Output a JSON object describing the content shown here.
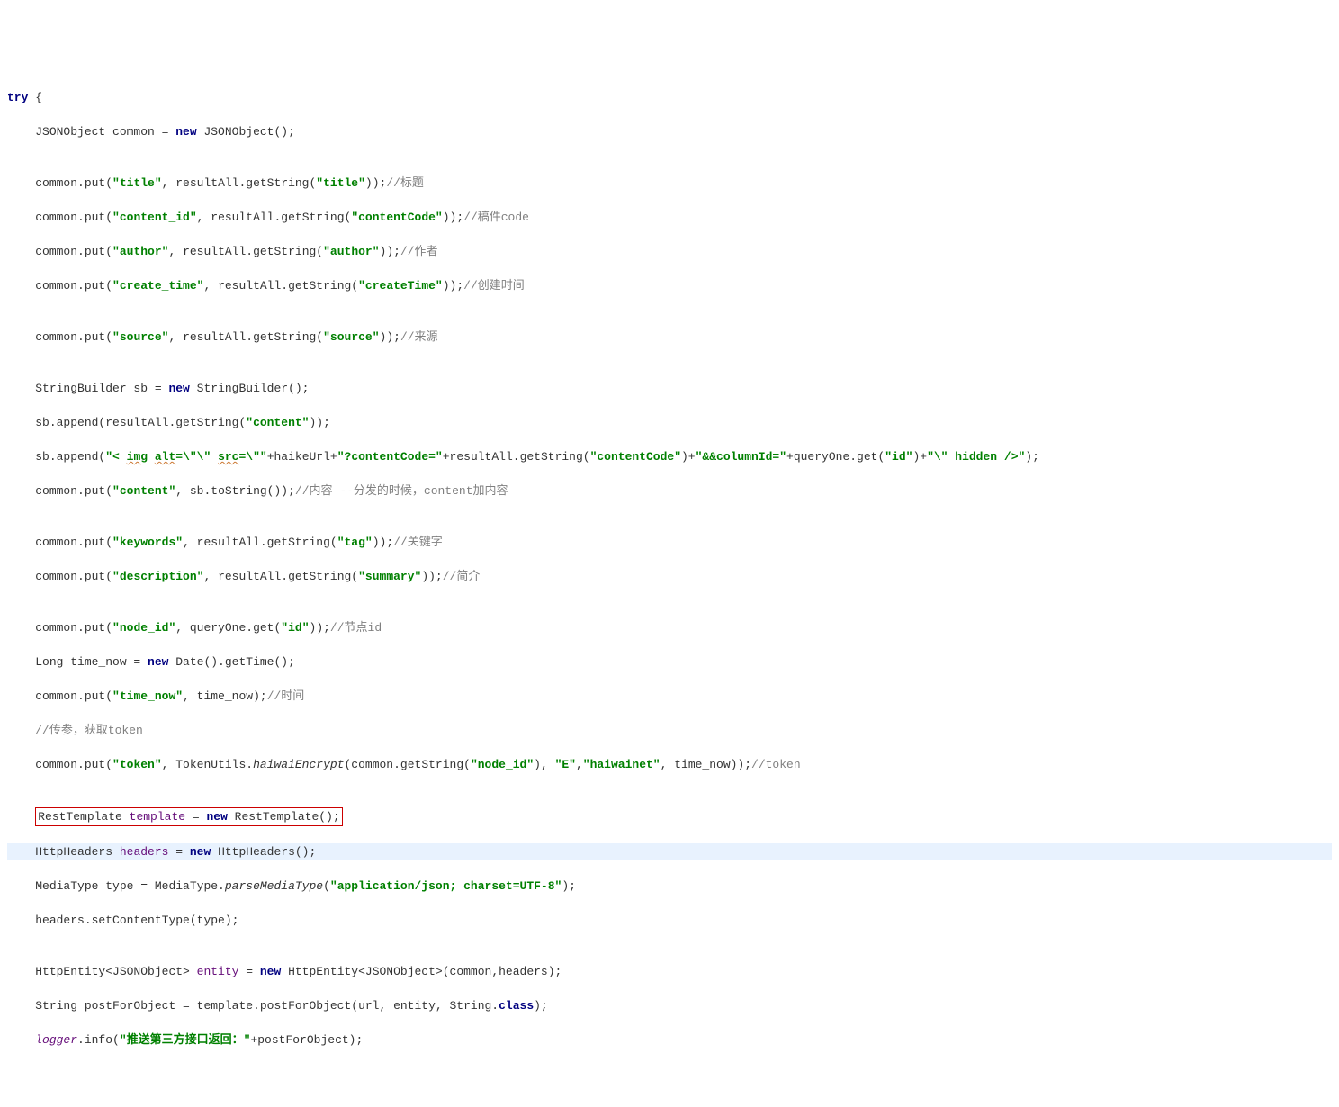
{
  "code": {
    "l1": {
      "kw": "try",
      "brace": " {"
    },
    "l2": {
      "p1": "JSONObject common = ",
      "kw": "new",
      "p2": " JSONObject();"
    },
    "l3": {
      "p1": "common.put(",
      "s1": "\"title\"",
      "p2": ", resultAll.getString(",
      "s2": "\"title\"",
      "p3": "));",
      "c": "//标题"
    },
    "l4": {
      "p1": "common.put(",
      "s1": "\"content_id\"",
      "p2": ", resultAll.getString(",
      "s2": "\"contentCode\"",
      "p3": "));",
      "c": "//稿件code"
    },
    "l5": {
      "p1": "common.put(",
      "s1": "\"author\"",
      "p2": ", resultAll.getString(",
      "s2": "\"author\"",
      "p3": "));",
      "c": "//作者"
    },
    "l6": {
      "p1": "common.put(",
      "s1": "\"create_time\"",
      "p2": ", resultAll.getString(",
      "s2": "\"createTime\"",
      "p3": "));",
      "c": "//创建时间"
    },
    "l7": {
      "p1": "common.put(",
      "s1": "\"source\"",
      "p2": ", resultAll.getString(",
      "s2": "\"source\"",
      "p3": "));",
      "c": "//来源"
    },
    "l8": {
      "p1": "StringBuilder sb = ",
      "kw": "new",
      "p2": " StringBuilder();"
    },
    "l9": {
      "p1": "sb.append(resultAll.getString(",
      "s1": "\"content\"",
      "p2": "));"
    },
    "l10": {
      "p1": "sb.append(",
      "s1": "\"< ",
      "w1": "img",
      "s2": " ",
      "w2": "alt",
      "s3": "=\\\"\\\" ",
      "w3": "src",
      "s4": "=\\\"\"",
      "p2": "+haikeUrl+",
      "s5": "\"?contentCode=\"",
      "p3": "+resultAll.getString(",
      "s6": "\"contentCode\"",
      "p4": ")+",
      "s7": "\"&&columnId=\"",
      "p5": "+queryOne.get(",
      "s8": "\"id\"",
      "p6": ")+",
      "s9": "\"\\\" hidden />\"",
      "p7": ");"
    },
    "l11": {
      "p1": "common.put(",
      "s1": "\"content\"",
      "p2": ", sb.toString());",
      "c": "//内容 --分发的时候，content加内容"
    },
    "l12": {
      "p1": "common.put(",
      "s1": "\"keywords\"",
      "p2": ", resultAll.getString(",
      "s2": "\"tag\"",
      "p3": "));",
      "c": "//关键字"
    },
    "l13": {
      "p1": "common.put(",
      "s1": "\"description\"",
      "p2": ", resultAll.getString(",
      "s2": "\"summary\"",
      "p3": "));",
      "c": "//简介"
    },
    "l14": {
      "p1": "common.put(",
      "s1": "\"node_id\"",
      "p2": ", queryOne.get(",
      "s2": "\"id\"",
      "p3": "));",
      "c": "//节点id"
    },
    "l15": {
      "p1": "Long time_now = ",
      "kw": "new",
      "p2": " Date().getTime();"
    },
    "l16": {
      "p1": "common.put(",
      "s1": "\"time_now\"",
      "p2": ", time_now);",
      "c": "//时间"
    },
    "l17": {
      "c": "//传参，获取token"
    },
    "l18": {
      "p1": "common.put(",
      "s1": "\"token\"",
      "p2": ", TokenUtils.",
      "m": "haiwaiEncrypt",
      "p3": "(common.getString(",
      "s2": "\"node_id\"",
      "p4": "), ",
      "s3": "\"E\"",
      "p5": ",",
      "s4": "\"haiwainet\"",
      "p6": ", time_now));",
      "c": "//token"
    },
    "l19": {
      "p1": "RestTemplate ",
      "v": "template",
      "p2": " = ",
      "kw": "new",
      "p3": " RestTemplate();"
    },
    "l20": {
      "p1": "HttpHeaders ",
      "v": "headers",
      "p2": " = ",
      "kw": "new",
      "p3": " HttpHeaders();"
    },
    "l21": {
      "p1": "MediaType type = MediaType.",
      "m": "parseMediaType",
      "p2": "(",
      "s1": "\"application/json; charset=UTF-8\"",
      "p3": ");"
    },
    "l22": {
      "p1": "headers.setContentType(type);"
    },
    "l23": {
      "p1": "HttpEntity<JSONObject> ",
      "v": "entity",
      "p2": " = ",
      "kw": "new",
      "p3": " HttpEntity<JSONObject>(common,headers);"
    },
    "l24": {
      "p1": "String postForObject = template.postForObject(url, entity, String.",
      "kw2": "class",
      "p2": ");"
    },
    "l25": {
      "v": "logger",
      "p1": ".info(",
      "s1": "\"推送第三方接口返回：\"",
      "p2": "+postForObject);"
    }
  }
}
